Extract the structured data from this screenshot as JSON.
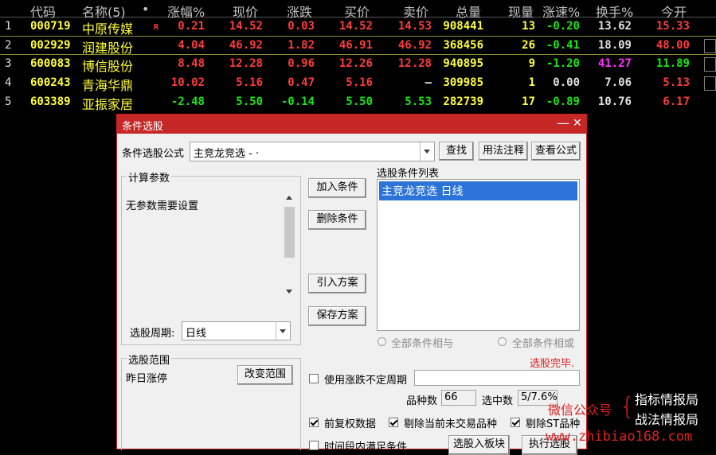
{
  "table": {
    "headers": [
      "代码",
      "名称(5)",
      "•",
      "涨幅%",
      "现价",
      "涨跌",
      "买价",
      "卖价",
      "总量",
      "现量",
      "涨速%",
      "换手%",
      "今开"
    ],
    "rows": [
      {
        "idx": "1",
        "code": "000719",
        "name": "中原传媒",
        "flag": "R",
        "pct": "0.21",
        "price": "14.52",
        "chg": "0.03",
        "bid": "14.52",
        "ask": "14.53",
        "vol": "908441",
        "cur": "13",
        "spd": "-0.20",
        "turn": "13.62",
        "open": "15.33"
      },
      {
        "idx": "2",
        "code": "002929",
        "name": "润建股份",
        "flag": "",
        "pct": "4.04",
        "price": "46.92",
        "chg": "1.82",
        "bid": "46.91",
        "ask": "46.92",
        "vol": "368456",
        "cur": "26",
        "spd": "-0.41",
        "turn": "18.09",
        "open": "48.00"
      },
      {
        "idx": "3",
        "code": "600083",
        "name": "博信股份",
        "flag": "",
        "pct": "8.48",
        "price": "12.28",
        "chg": "0.96",
        "bid": "12.26",
        "ask": "12.28",
        "vol": "940895",
        "cur": "9",
        "spd": "-1.20",
        "turn": "41.27",
        "open": "11.89"
      },
      {
        "idx": "4",
        "code": "600243",
        "name": "青海华鼎",
        "flag": "",
        "pct": "10.02",
        "price": "5.16",
        "chg": "0.47",
        "bid": "5.16",
        "ask": "—",
        "vol": "309985",
        "cur": "1",
        "spd": "0.00",
        "turn": "7.06",
        "open": "5.13"
      },
      {
        "idx": "5",
        "code": "603389",
        "name": "亚振家居",
        "flag": "",
        "pct": "-2.48",
        "price": "5.50",
        "chg": "-0.14",
        "bid": "5.50",
        "ask": "5.53",
        "vol": "282739",
        "cur": "17",
        "spd": "-0.89",
        "turn": "10.76",
        "open": "6.17"
      }
    ]
  },
  "dialog": {
    "title": "条件选股",
    "minimize": "—",
    "close": "✕",
    "formula_label": "条件选股公式",
    "formula_value": "主竞龙竞选 - ·",
    "find_btn": "查找",
    "usage_btn": "用法注释",
    "view_btn": "查看公式",
    "params_group": "计算参数",
    "params_text": "无参数需要设置",
    "period_label": "选股周期:",
    "period_value": "日线",
    "add_btn": "加入条件",
    "del_btn": "删除条件",
    "import_btn": "引入方案",
    "save_btn": "保存方案",
    "list_label": "选股条件列表",
    "list_items": [
      "主竞龙竞选  日线"
    ],
    "radio_and": "全部条件相与",
    "radio_or": "全部条件相或",
    "status": "选股完毕.",
    "range_group": "选股范围",
    "range_text": "昨日涨停",
    "range_btn": "改变范围",
    "use_period_label": "使用涨跌不定周期",
    "count_label": "品种数",
    "count_value": "66",
    "selected_label": "选中数",
    "selected_value": "5/7.6%",
    "chk_adjust": "前复权数据",
    "chk_untraded": "剔除当前未交易品种",
    "chk_st": "剔除ST品种",
    "chk_period": "时间段内满足条件",
    "to_block_btn": "选股入板块",
    "run_btn": "执行选股"
  },
  "watermark": {
    "wechat": "微信公众号",
    "brace": "{",
    "line1": "指标情报局",
    "line2": "战法情报局",
    "url": "www.zhibiao168.com"
  }
}
